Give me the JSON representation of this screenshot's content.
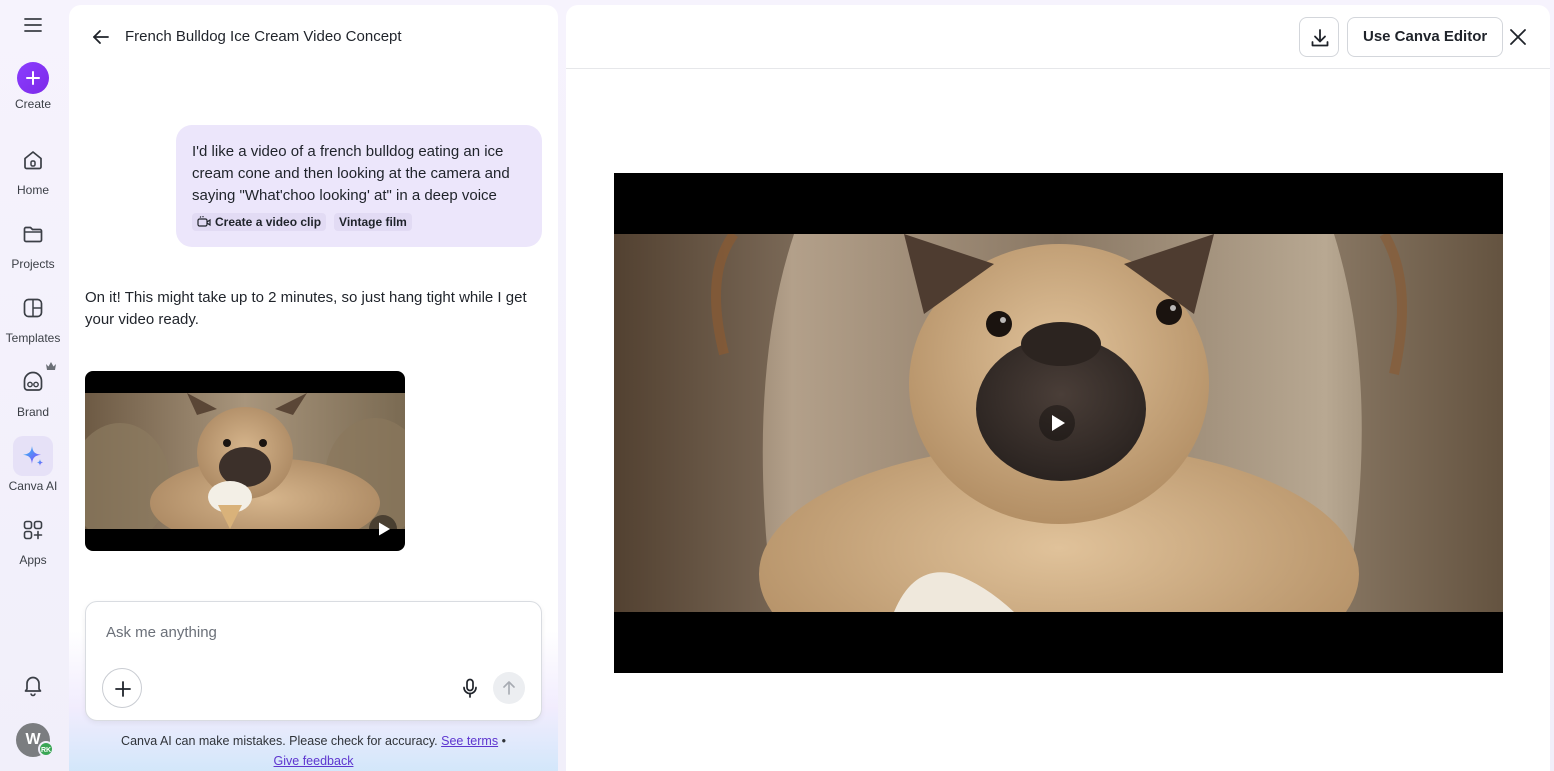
{
  "rail": {
    "items": [
      {
        "label": "Create"
      },
      {
        "label": "Home"
      },
      {
        "label": "Projects"
      },
      {
        "label": "Templates"
      },
      {
        "label": "Brand"
      },
      {
        "label": "Canva AI"
      },
      {
        "label": "Apps"
      }
    ],
    "avatar_initial": "W",
    "avatar_badge": "RK",
    "accent_color": "#8b3dff"
  },
  "chat": {
    "title": "French Bulldog Ice Cream Video Concept",
    "user_message": "I'd like a video of a french bulldog eating an ice cream cone and then looking at the camera and saying \"What'choo looking' at\" in a deep voice",
    "chips": [
      "Create a video clip",
      "Vintage film"
    ],
    "ai_message": "On it! This might take up to 2 minutes, so just hang tight while I get your video ready.",
    "composer_placeholder": "Ask me anything",
    "disclaimer_text": "Canva AI can make mistakes. Please check for accuracy.",
    "see_terms": "See terms",
    "separator": "•",
    "give_feedback": "Give feedback"
  },
  "preview": {
    "use_editor_label": "Use Canva Editor"
  }
}
